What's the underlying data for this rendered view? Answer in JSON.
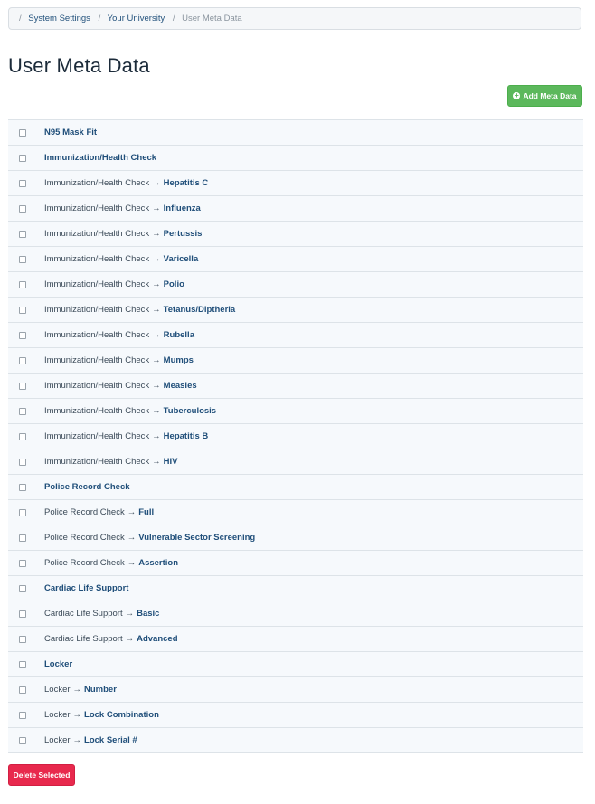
{
  "breadcrumb": {
    "separator": "/",
    "items": [
      "System Settings",
      "Your University"
    ],
    "current": "User Meta Data"
  },
  "page_title": "User Meta Data",
  "add_button": {
    "icon": "plus-circle-icon",
    "label": "Add Meta Data",
    "color": "#5cb85c"
  },
  "arrow": "→",
  "rows": [
    {
      "prefix": "",
      "name": "N95 Mask Fit"
    },
    {
      "prefix": "",
      "name": "Immunization/Health Check"
    },
    {
      "prefix": "Immunization/Health Check",
      "name": "Hepatitis C"
    },
    {
      "prefix": "Immunization/Health Check",
      "name": "Influenza"
    },
    {
      "prefix": "Immunization/Health Check",
      "name": "Pertussis"
    },
    {
      "prefix": "Immunization/Health Check",
      "name": "Varicella"
    },
    {
      "prefix": "Immunization/Health Check",
      "name": "Polio"
    },
    {
      "prefix": "Immunization/Health Check",
      "name": "Tetanus/Diptheria"
    },
    {
      "prefix": "Immunization/Health Check",
      "name": "Rubella"
    },
    {
      "prefix": "Immunization/Health Check",
      "name": "Mumps"
    },
    {
      "prefix": "Immunization/Health Check",
      "name": "Measles"
    },
    {
      "prefix": "Immunization/Health Check",
      "name": "Tuberculosis"
    },
    {
      "prefix": "Immunization/Health Check",
      "name": "Hepatitis B"
    },
    {
      "prefix": "Immunization/Health Check",
      "name": "HIV"
    },
    {
      "prefix": "",
      "name": "Police Record Check"
    },
    {
      "prefix": "Police Record Check",
      "name": "Full"
    },
    {
      "prefix": "Police Record Check",
      "name": "Vulnerable Sector Screening"
    },
    {
      "prefix": "Police Record Check",
      "name": "Assertion"
    },
    {
      "prefix": "",
      "name": "Cardiac Life Support"
    },
    {
      "prefix": "Cardiac Life Support",
      "name": "Basic"
    },
    {
      "prefix": "Cardiac Life Support",
      "name": "Advanced"
    },
    {
      "prefix": "",
      "name": "Locker"
    },
    {
      "prefix": "Locker",
      "name": "Number"
    },
    {
      "prefix": "Locker",
      "name": "Lock Combination"
    },
    {
      "prefix": "Locker",
      "name": "Lock Serial #"
    }
  ],
  "delete_button": {
    "label": "Delete Selected",
    "color": "#e8294d"
  }
}
